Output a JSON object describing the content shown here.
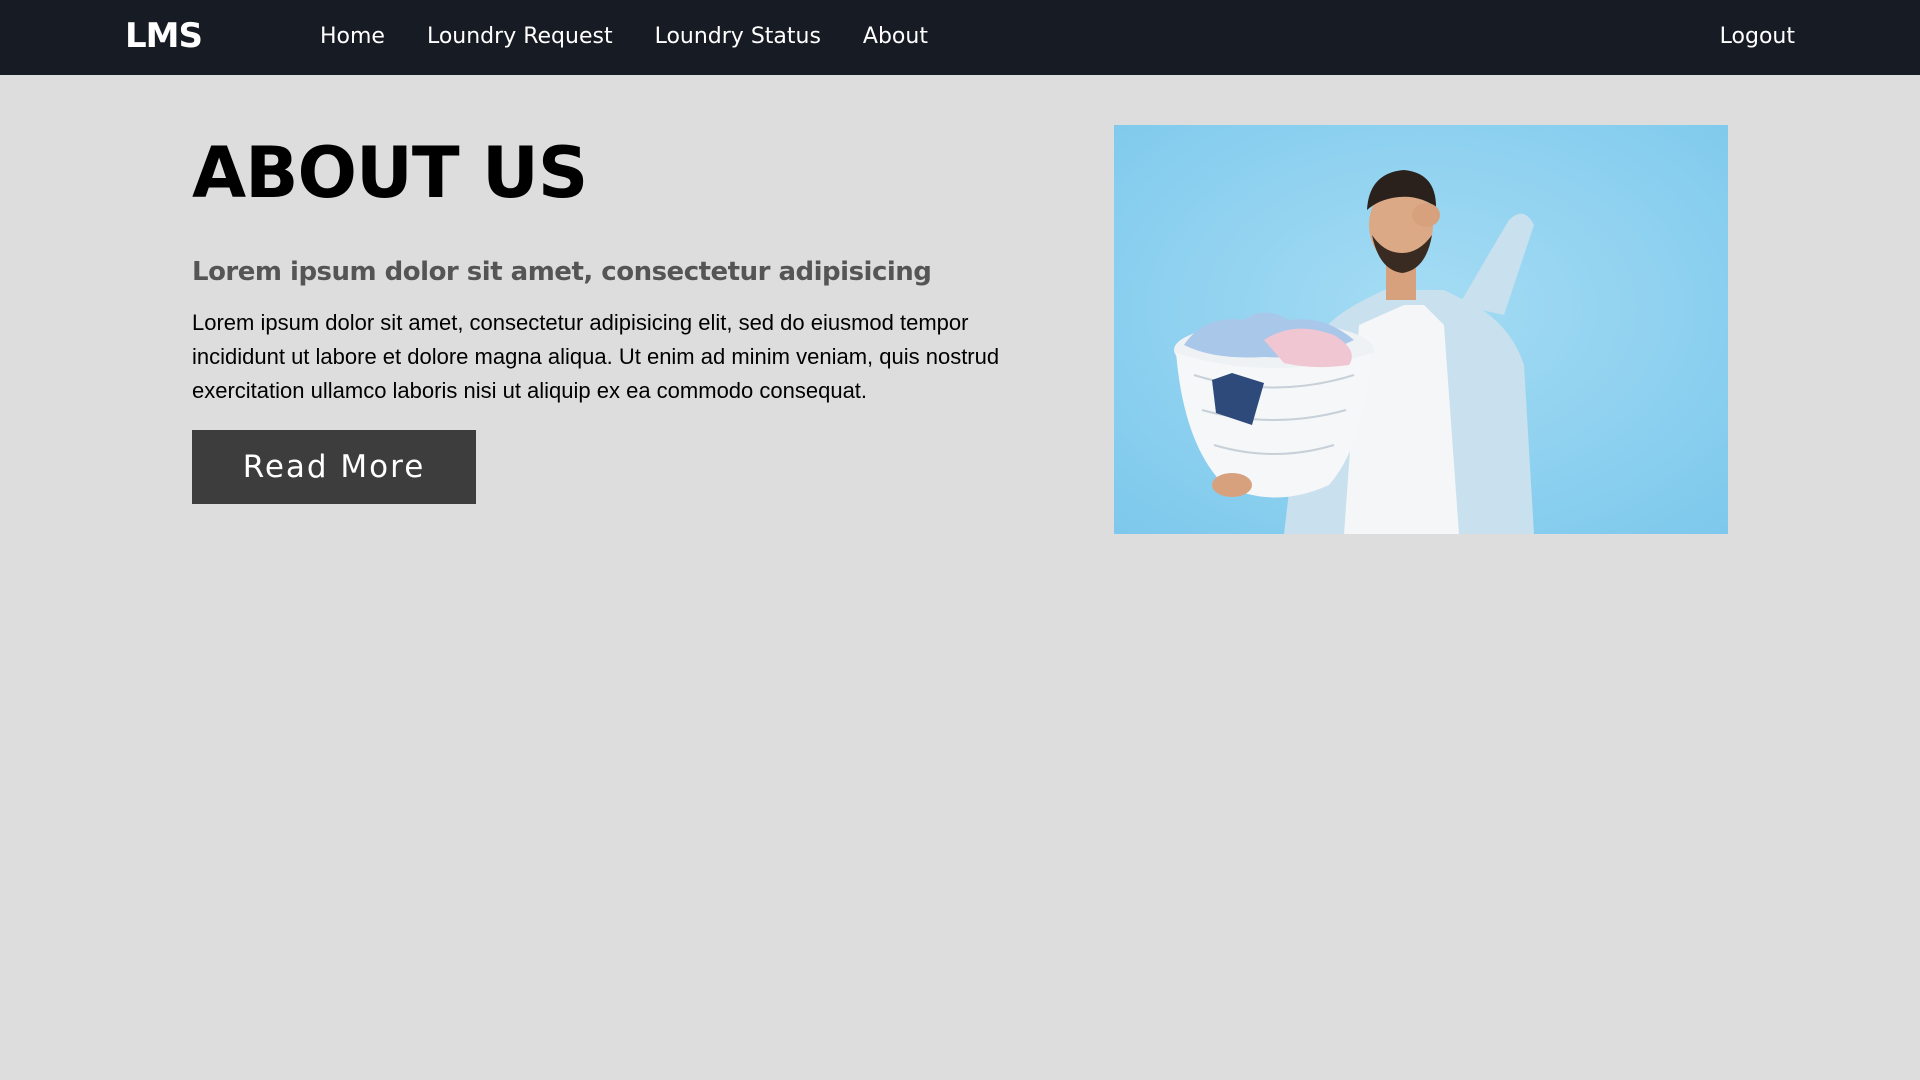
{
  "navbar": {
    "brand": "LMS",
    "links": [
      {
        "label": "Home"
      },
      {
        "label": "Loundry Request"
      },
      {
        "label": "Loundry Status"
      },
      {
        "label": "About"
      }
    ],
    "logout_label": "Logout",
    "background_color": "#171b24"
  },
  "about": {
    "title": "ABOUT US",
    "subtitle": "Lorem ipsum dolor sit amet, consectetur adipisicing",
    "body": "Lorem ipsum dolor sit amet, consectetur adipisicing elit, sed do eiusmod tempor incididunt ut labore et dolore magna aliqua. Ut enim ad minim veniam, quis nostrud exercitation ullamco laboris nisi ut aliquip ex ea commodo consequat.",
    "read_more_label": "Read More",
    "image": {
      "icon": "laundry-photo",
      "background_color": "#8fd1ef"
    }
  },
  "colors": {
    "page_background": "#dddddd",
    "button_background": "#3d3d3d"
  }
}
